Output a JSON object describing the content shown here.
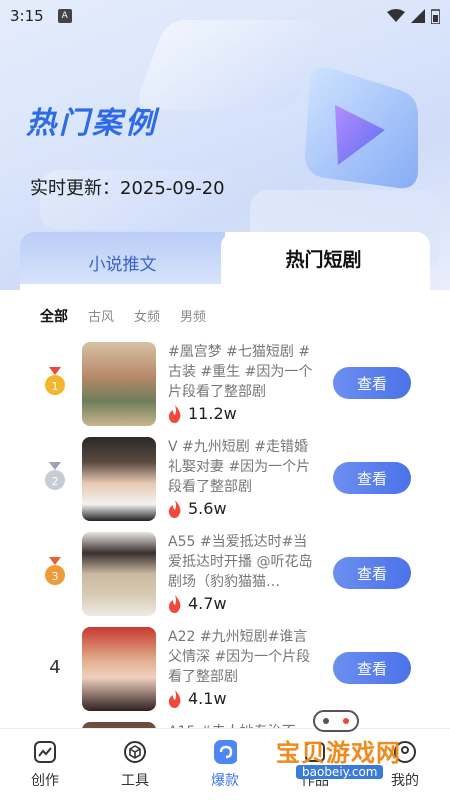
{
  "status_bar": {
    "time": "3:15",
    "app_badge": "A"
  },
  "header": {
    "title": "热门案例",
    "update_text": "实时更新：2025-09-20"
  },
  "tabs": {
    "left": "小说推文",
    "right": "热门短剧"
  },
  "filters": [
    "全部",
    "古风",
    "女频",
    "男频"
  ],
  "items": [
    {
      "rank": "1",
      "desc": "#凰宫梦 #七猫短剧 #古装 #重生 #因为一个片段看了整部剧",
      "heat": "11.2w",
      "action": "查看"
    },
    {
      "rank": "2",
      "desc": "V #九州短剧 #走错婚礼娶对妻 #因为一个片段看了整部剧",
      "heat": "5.6w",
      "action": "查看"
    },
    {
      "rank": "3",
      "desc": "A55 #当爱抵达时#当爱抵达时开播 @听花岛剧场（豹豹猫猫…",
      "heat": "4.7w",
      "action": "查看"
    },
    {
      "rank": "4",
      "desc": "A22 #九州短剧#谁言父情深 #因为一个片段看了整部剧",
      "heat": "4.1w",
      "action": "查看"
    },
    {
      "rank": "",
      "desc": "A15 #夫人她专治不",
      "heat": "",
      "action": ""
    }
  ],
  "nav": [
    {
      "label": "创作",
      "icon": "chart-icon"
    },
    {
      "label": "工具",
      "icon": "box-icon"
    },
    {
      "label": "爆款",
      "icon": "hot-icon"
    },
    {
      "label": "作品",
      "icon": "works-icon"
    },
    {
      "label": "我的",
      "icon": "profile-icon"
    }
  ],
  "watermark": {
    "text": "宝贝游戏网",
    "url": "baobeiy.com"
  },
  "colors": {
    "accent": "#3d73ee",
    "title": "#2d6be8",
    "flame": "#f04a3a"
  }
}
